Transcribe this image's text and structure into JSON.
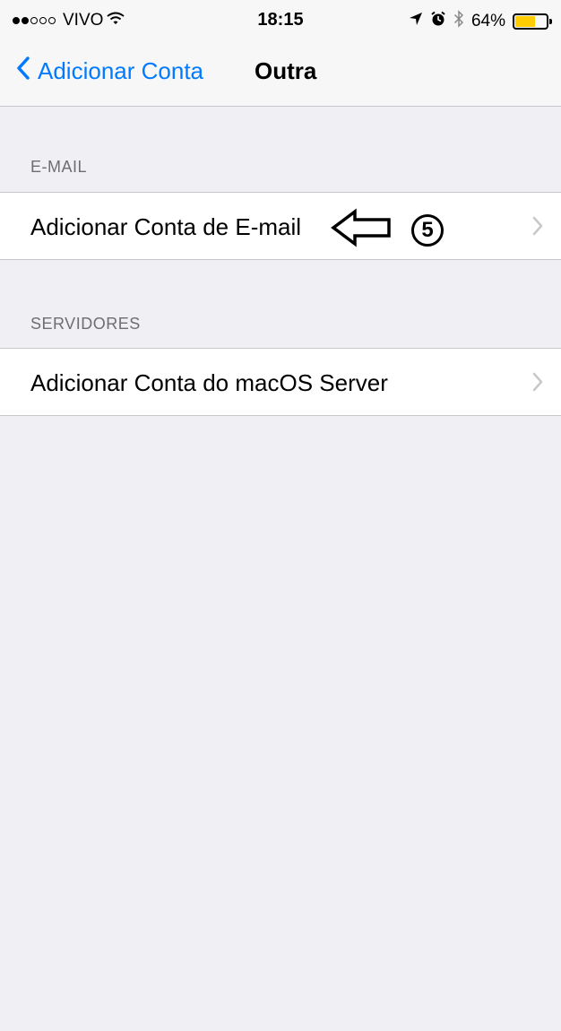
{
  "status_bar": {
    "carrier": "VIVO",
    "time": "18:15",
    "battery": "64%",
    "battery_level": 0.64,
    "battery_color": "#ffcc00"
  },
  "nav": {
    "back_label": "Adicionar Conta",
    "title": "Outra",
    "accent_color": "#007aff"
  },
  "sections": [
    {
      "header": "E-MAIL",
      "items": [
        {
          "label": "Adicionar Conta de E-mail",
          "annotation_number": "5"
        }
      ]
    },
    {
      "header": "SERVIDORES",
      "items": [
        {
          "label": "Adicionar Conta do macOS Server"
        }
      ]
    }
  ],
  "icons": {
    "back": "chevron-left-icon",
    "disclosure": "chevron-right-icon",
    "wifi": "wifi-icon",
    "location": "location-arrow-icon",
    "alarm": "alarm-icon",
    "bluetooth": "bluetooth-icon",
    "annotation_arrow": "arrow-left-outline-icon",
    "annotation_badge": "circled-number-icon"
  }
}
